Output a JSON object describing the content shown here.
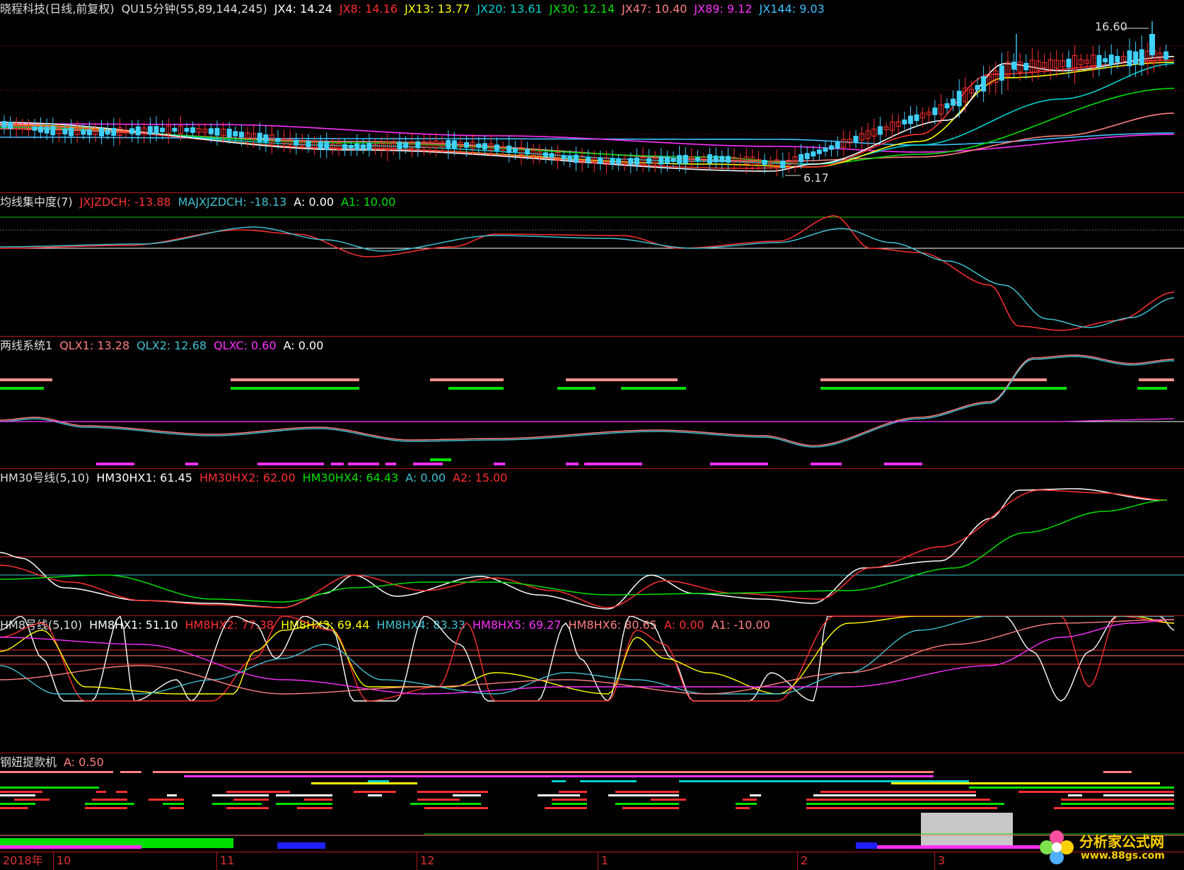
{
  "main_panel": {
    "legend": [
      {
        "text": "晓程科技(日线,前复权)",
        "color": "#dddddd"
      },
      {
        "text": "QU15分钟(55,89,144,245)",
        "color": "#dddddd"
      },
      {
        "text": "JX4: 14.24",
        "color": "#ffffff"
      },
      {
        "text": "JX8: 14.16",
        "color": "#ff3030"
      },
      {
        "text": "JX13: 13.77",
        "color": "#ffff00"
      },
      {
        "text": "JX20: 13.61",
        "color": "#00d0d0"
      },
      {
        "text": "JX30: 12.14",
        "color": "#00e000"
      },
      {
        "text": "JX47: 10.40",
        "color": "#ff8080"
      },
      {
        "text": "JX89: 9.12",
        "color": "#ff30ff"
      },
      {
        "text": "JX144: 9.03",
        "color": "#40c0ff"
      }
    ],
    "high_label": "16.60",
    "low_label": "6.17"
  },
  "panel2": {
    "legend": [
      {
        "text": "均线集中度(7)",
        "color": "#dddddd"
      },
      {
        "text": "JXJZDCH: -13.88",
        "color": "#ff3030"
      },
      {
        "text": "MAJXJZDCH: -18.13",
        "color": "#40c0d0"
      },
      {
        "text": "A: 0.00",
        "color": "#ffffff"
      },
      {
        "text": "A1: 10.00",
        "color": "#00e000"
      }
    ]
  },
  "panel3": {
    "legend": [
      {
        "text": "两线系统1",
        "color": "#dddddd"
      },
      {
        "text": "QLX1: 13.28",
        "color": "#ff8080"
      },
      {
        "text": "QLX2: 12.68",
        "color": "#40c0d0"
      },
      {
        "text": "QLXC: 0.60",
        "color": "#ff30ff"
      },
      {
        "text": "A: 0.00",
        "color": "#ffffff"
      }
    ]
  },
  "panel4": {
    "legend": [
      {
        "text": "HM30号线(5,10)",
        "color": "#dddddd"
      },
      {
        "text": "HM30HX1: 61.45",
        "color": "#ffffff"
      },
      {
        "text": "HM30HX2: 62.00",
        "color": "#ff3030"
      },
      {
        "text": "HM30HX4: 64.43",
        "color": "#00e000"
      },
      {
        "text": "A: 0.00",
        "color": "#40c0d0"
      },
      {
        "text": "A2: 15.00",
        "color": "#ff3030"
      }
    ]
  },
  "panel5": {
    "legend": [
      {
        "text": "HM8号线(5,10)",
        "color": "#dddddd"
      },
      {
        "text": "HM8HX1: 51.10",
        "color": "#ffffff"
      },
      {
        "text": "HM8HX2: 77.38",
        "color": "#ff3030"
      },
      {
        "text": "HM8HX3: 69.44",
        "color": "#ffff00"
      },
      {
        "text": "HM8HX4: 83.33",
        "color": "#40c0d0"
      },
      {
        "text": "HM8HX5: 69.27",
        "color": "#ff30ff"
      },
      {
        "text": "HM8HX6: 80.65",
        "color": "#ff8080"
      },
      {
        "text": "A: 0.00",
        "color": "#ff3030"
      },
      {
        "text": "A1: -10.00",
        "color": "#ff8080"
      }
    ]
  },
  "panel6": {
    "legend": [
      {
        "text": "钢妞提款机",
        "color": "#dddddd"
      },
      {
        "text": "A: 0.50",
        "color": "#ff8080"
      }
    ]
  },
  "date_axis": [
    {
      "label": "2018年",
      "frac": 0.0
    },
    {
      "label": "10",
      "frac": 0.045
    },
    {
      "label": "11",
      "frac": 0.183
    },
    {
      "label": "12",
      "frac": 0.352
    },
    {
      "label": "1",
      "frac": 0.505
    },
    {
      "label": "2",
      "frac": 0.673
    },
    {
      "label": "3",
      "frac": 0.789
    }
  ],
  "watermark": {
    "cn": "分析家公式网",
    "url": "www.88gs.com"
  }
}
